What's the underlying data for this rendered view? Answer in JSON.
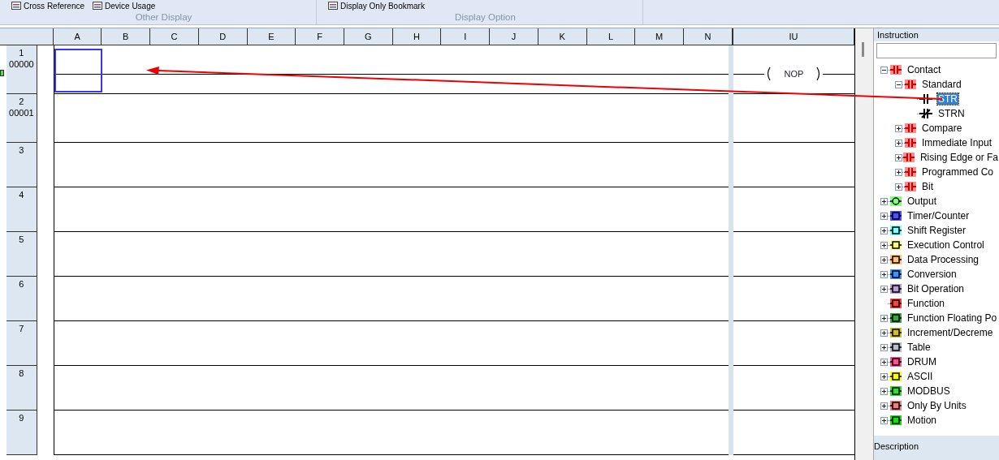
{
  "ribbon": {
    "groups": [
      {
        "label": "Other Display",
        "items": [
          "Cross Reference",
          "Device Usage"
        ]
      },
      {
        "label": "Display Option",
        "items": [
          "Display Only Bookmark"
        ]
      }
    ]
  },
  "ladder": {
    "columns": [
      "A",
      "B",
      "C",
      "D",
      "E",
      "F",
      "G",
      "H",
      "I",
      "J",
      "K",
      "L",
      "M",
      "N"
    ],
    "output_column": "IU",
    "rows": [
      {
        "number": "1",
        "address": "00000",
        "current": true,
        "rung": true,
        "selected": true,
        "coil": "NOP"
      },
      {
        "number": "2",
        "address": "00001",
        "current": false,
        "rung": false,
        "selected": false
      },
      {
        "number": "3",
        "current": false,
        "rung": false,
        "selected": false
      },
      {
        "number": "4",
        "current": false,
        "rung": false,
        "selected": false
      },
      {
        "number": "5",
        "current": false,
        "rung": false,
        "selected": false
      },
      {
        "number": "6",
        "current": false,
        "rung": false,
        "selected": false
      },
      {
        "number": "7",
        "current": false,
        "rung": false,
        "selected": false
      },
      {
        "number": "8",
        "current": false,
        "rung": false,
        "selected": false
      },
      {
        "number": "9",
        "current": false,
        "rung": false,
        "selected": false
      }
    ]
  },
  "instruction_panel": {
    "title": "Instruction",
    "description_title": "Description",
    "tree": [
      {
        "label": "Contact",
        "kind": "contact",
        "color": "#ff8c8c",
        "expanded": true,
        "selected": false,
        "children": [
          {
            "label": "Standard",
            "kind": "contact",
            "color": "#ff8c8c",
            "expanded": true,
            "selected": false,
            "children": [
              {
                "label": "STR",
                "kind": "contact-no",
                "selected": true
              },
              {
                "label": "STRN",
                "kind": "contact-nc",
                "selected": false
              }
            ]
          },
          {
            "label": "Compare",
            "kind": "contact",
            "color": "#ff8c8c",
            "expanded": false,
            "selected": false
          },
          {
            "label": "Immediate Input",
            "kind": "contact",
            "color": "#ff8c8c",
            "expanded": false,
            "selected": false
          },
          {
            "label": "Rising Edge or Fa",
            "kind": "contact",
            "color": "#ff8c8c",
            "expanded": false,
            "selected": false
          },
          {
            "label": "Programmed Co",
            "kind": "contact",
            "color": "#ff8c8c",
            "expanded": false,
            "selected": false
          },
          {
            "label": "Bit",
            "kind": "contact",
            "color": "#ff8c8c",
            "expanded": false,
            "selected": false
          }
        ]
      },
      {
        "label": "Output",
        "kind": "coil",
        "color": "#80ff80",
        "expanded": false,
        "selected": false
      },
      {
        "label": "Timer/Counter",
        "kind": "box",
        "color": "#5050ff",
        "expanded": false,
        "selected": false
      },
      {
        "label": "Shift Register",
        "kind": "box",
        "color": "#80ffff",
        "expanded": false,
        "selected": false
      },
      {
        "label": "Execution Control",
        "kind": "box",
        "color": "#ffff80",
        "expanded": false,
        "selected": false
      },
      {
        "label": "Data Processing",
        "kind": "box",
        "color": "#ffc080",
        "expanded": false,
        "selected": false
      },
      {
        "label": "Conversion",
        "kind": "box",
        "color": "#4090ff",
        "expanded": false,
        "selected": false
      },
      {
        "label": "Bit Operation",
        "kind": "box",
        "color": "#b8a0d0",
        "expanded": false,
        "selected": false
      },
      {
        "label": "Function",
        "kind": "box",
        "color": "#ff4040",
        "selected": false
      },
      {
        "label": "Function Floating Po",
        "kind": "box",
        "color": "#40a040",
        "expanded": false,
        "selected": false
      },
      {
        "label": "Increment/Decreme",
        "kind": "box",
        "color": "#d0c020",
        "expanded": false,
        "selected": false
      },
      {
        "label": "Table",
        "kind": "box",
        "color": "#b8bcc8",
        "expanded": false,
        "selected": false
      },
      {
        "label": "DRUM",
        "kind": "box",
        "color": "#ff5090",
        "expanded": false,
        "selected": false
      },
      {
        "label": "ASCII",
        "kind": "box",
        "color": "#ffff00",
        "expanded": false,
        "selected": false
      },
      {
        "label": "MODBUS",
        "kind": "box",
        "color": "#30e030",
        "expanded": false,
        "selected": false
      },
      {
        "label": "Only By Units",
        "kind": "box",
        "color": "#f08080",
        "expanded": false,
        "selected": false
      },
      {
        "label": "Motion",
        "kind": "box",
        "color": "#10e010",
        "expanded": false,
        "selected": false
      }
    ]
  }
}
